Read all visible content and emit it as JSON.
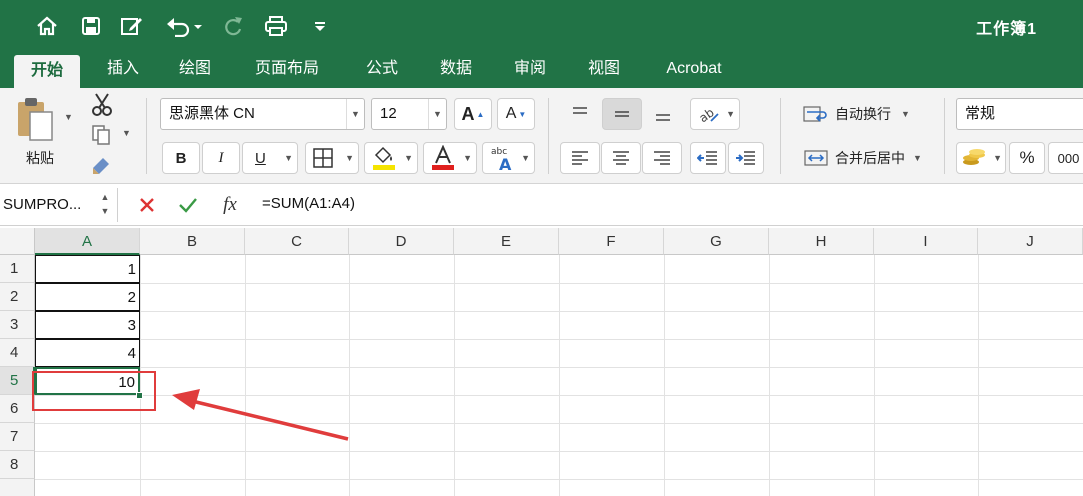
{
  "app": {
    "workbook_title": "工作簿1"
  },
  "quick_access": {
    "home_icon": "home-icon",
    "save_icon": "save-icon",
    "edit_icon": "edit-icon",
    "undo_icon": "undo-icon",
    "redo_icon": "redo-icon",
    "print_icon": "print-icon",
    "customize_icon": "customize-icon"
  },
  "tabs": [
    {
      "label": "开始",
      "active": true
    },
    {
      "label": "插入"
    },
    {
      "label": "绘图"
    },
    {
      "label": "页面布局"
    },
    {
      "label": "公式"
    },
    {
      "label": "数据"
    },
    {
      "label": "审阅"
    },
    {
      "label": "视图"
    },
    {
      "label": "Acrobat"
    }
  ],
  "ribbon": {
    "paste_label": "粘贴",
    "font_name": "思源黑体 CN",
    "font_size": "12",
    "bold_label": "B",
    "italic_label": "I",
    "underline_label": "U",
    "wrap_text_label": "自动换行",
    "merge_center_label": "合并后居中",
    "number_format": "常规",
    "percent_label": "%",
    "thousands_label": "000",
    "colors": {
      "highlight": "#f5e400",
      "font_color": "#e0201e",
      "accent": "#217346"
    }
  },
  "formula_bar": {
    "name_box": "SUMPRO...",
    "cancel_icon": "cancel-icon",
    "enter_icon": "check-icon",
    "fx_label": "fx",
    "formula": "=SUM(A1:A4)"
  },
  "sheet": {
    "columns": [
      "A",
      "B",
      "C",
      "D",
      "E",
      "F",
      "G",
      "H",
      "I",
      "J"
    ],
    "rows": [
      "1",
      "2",
      "3",
      "4",
      "5",
      "6",
      "7",
      "8"
    ],
    "active_cell": "A5",
    "cells": {
      "A1": "1",
      "A2": "2",
      "A3": "3",
      "A4": "4",
      "A5": "10"
    }
  },
  "annotation": {
    "color": "#e03c3c"
  }
}
